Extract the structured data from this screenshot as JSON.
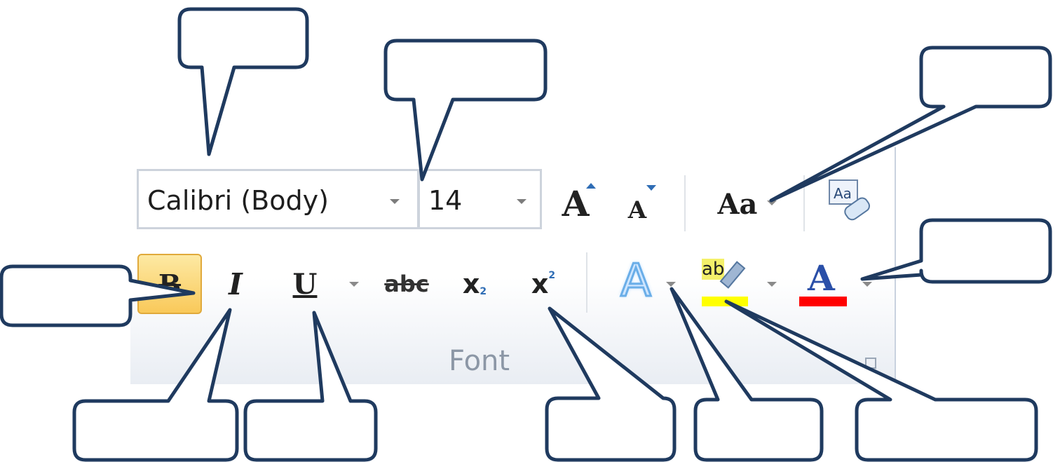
{
  "font_group": {
    "font_name": "Calibri (Body)",
    "font_size": "14",
    "group_label": "Font"
  },
  "buttons": {
    "bold": "B",
    "italic": "I",
    "underline": "U",
    "strikethrough": "abc",
    "subscript": "x",
    "subscript_mark": "2",
    "superscript": "x",
    "superscript_mark": "2",
    "grow_font": "A",
    "shrink_font": "A",
    "change_case": "Aa",
    "clear_formatting": "Aa",
    "text_effects": "A",
    "highlight": "ab",
    "font_color": "A"
  },
  "colors": {
    "highlight_bar": "#ffff00",
    "font_color_bar": "#ff0000",
    "bold_active_bg": "#fcd96a",
    "callout_stroke": "#1f3a5f"
  },
  "icons": [
    "bold-icon",
    "italic-icon",
    "underline-icon",
    "strikethrough-icon",
    "subscript-icon",
    "superscript-icon",
    "grow-font-icon",
    "shrink-font-icon",
    "change-case-icon",
    "clear-formatting-icon",
    "text-effects-icon",
    "highlight-icon",
    "font-color-icon",
    "dialog-launcher-icon"
  ]
}
